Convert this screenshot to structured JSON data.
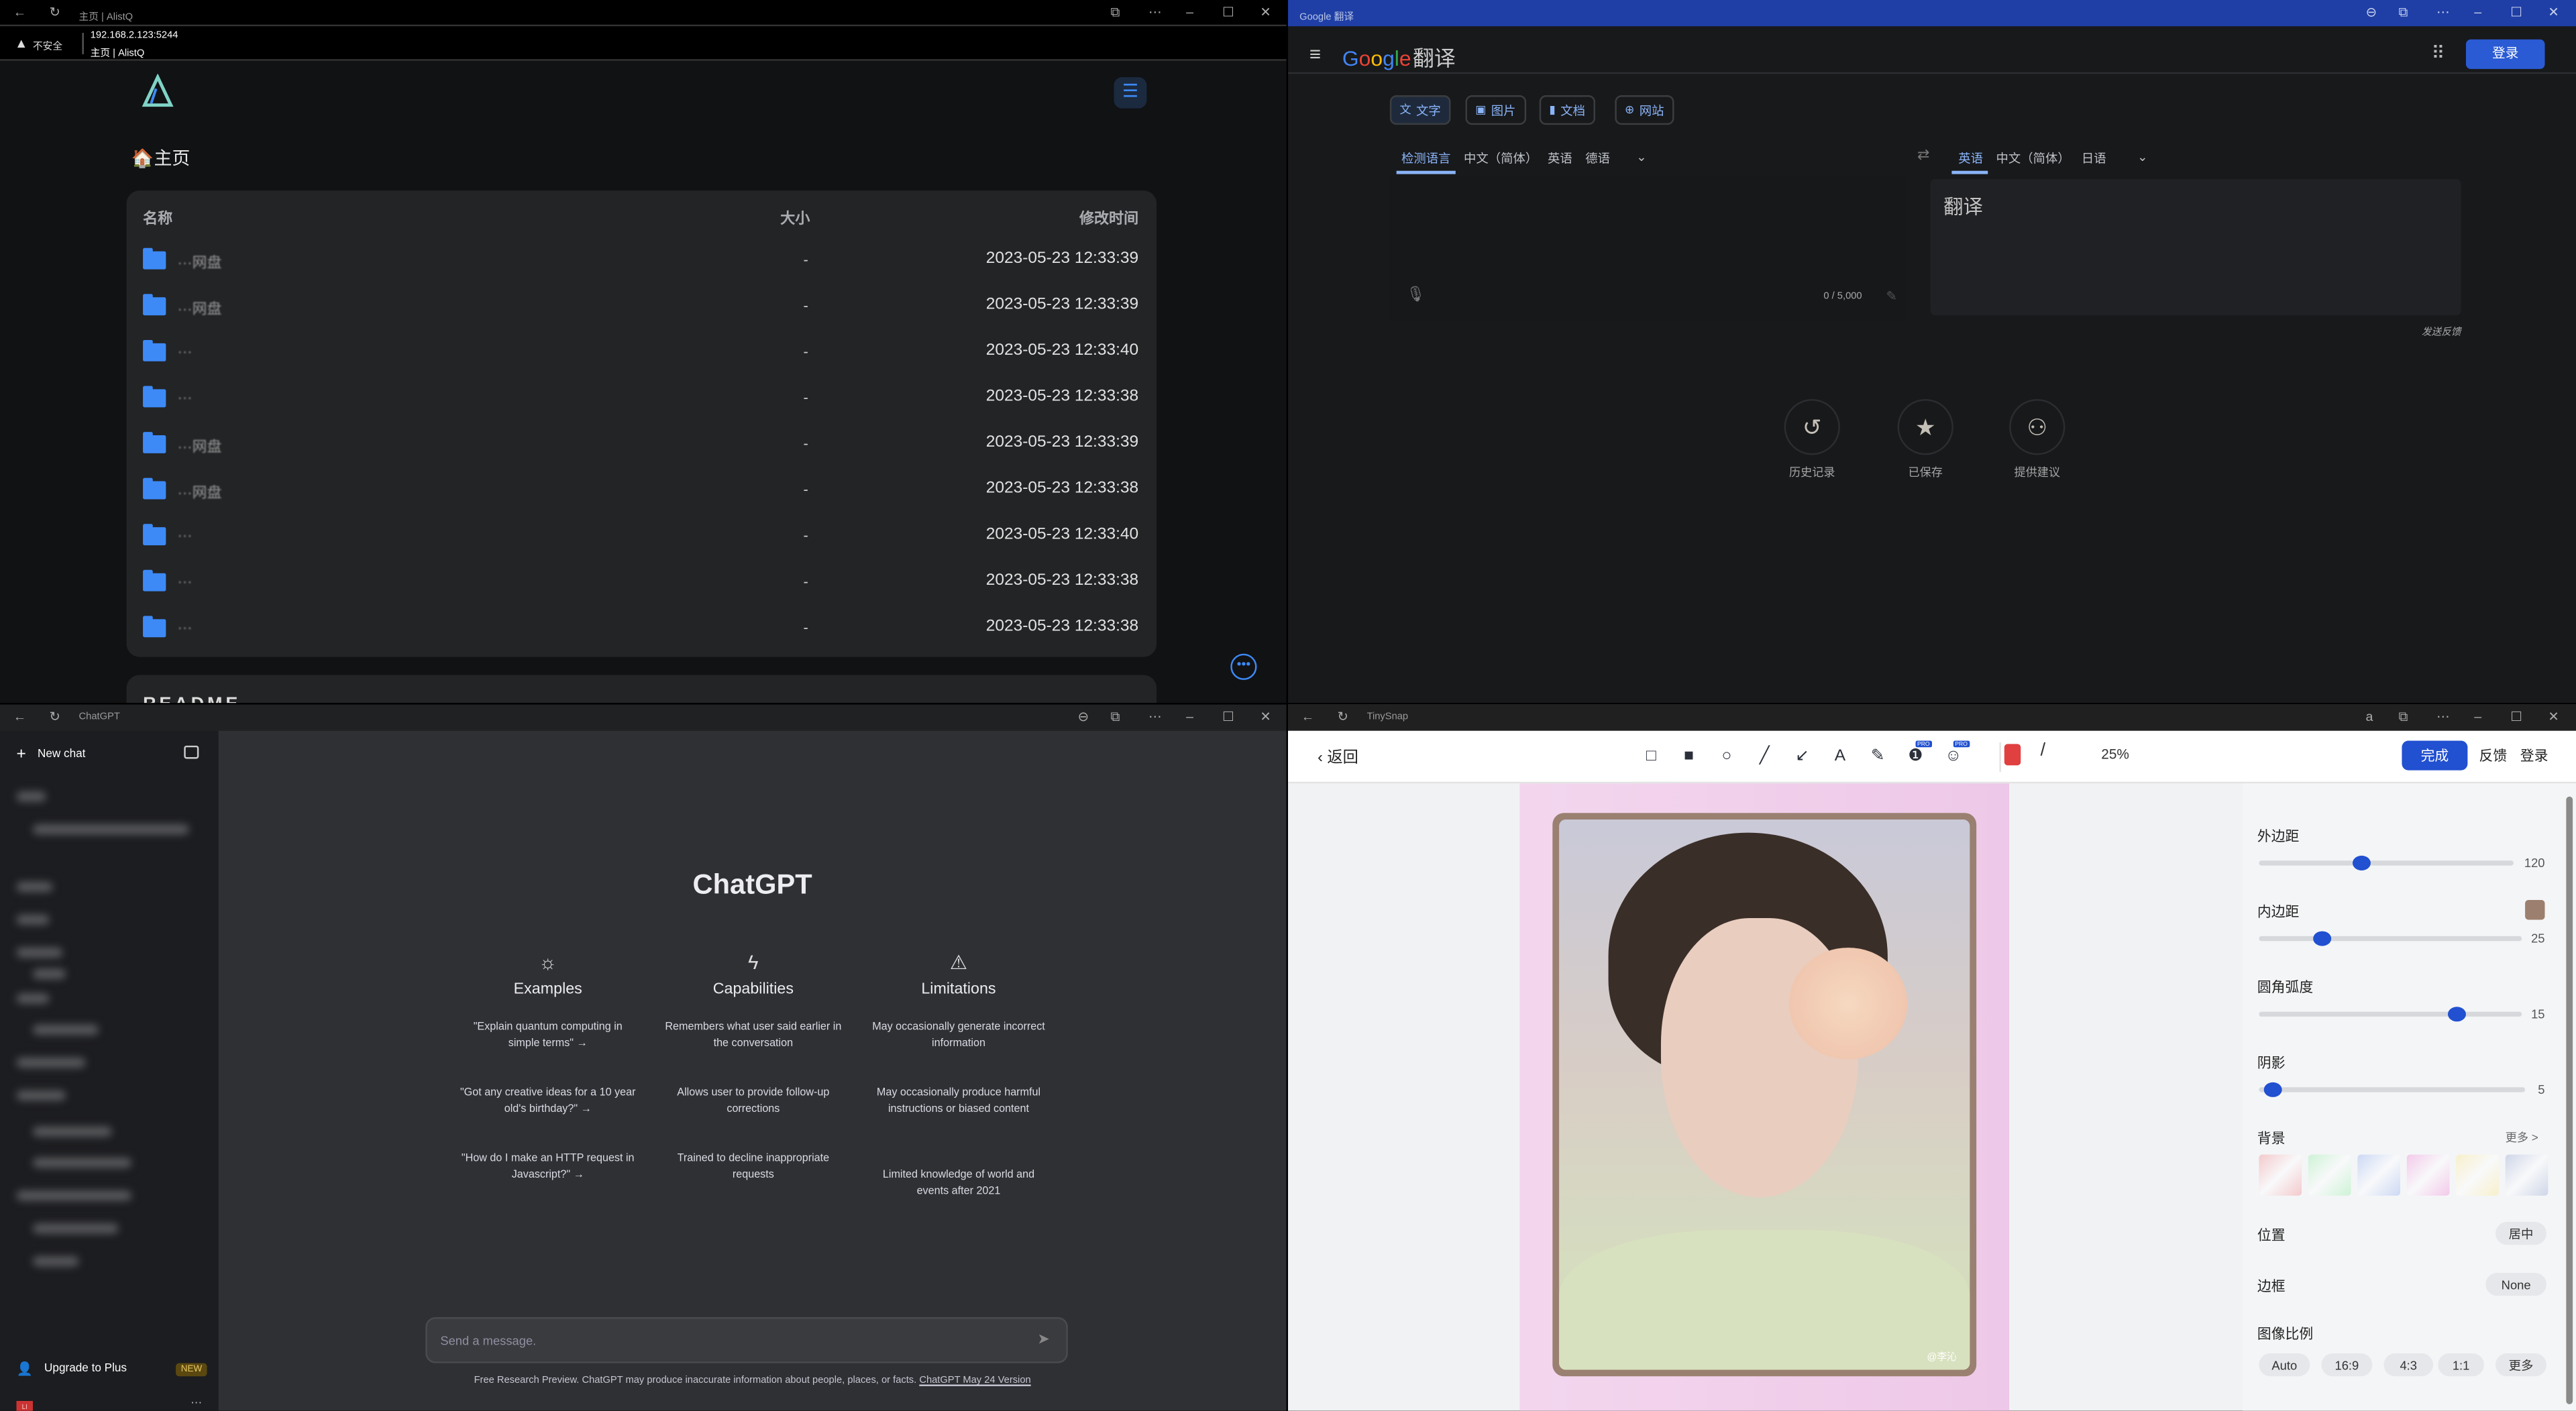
{
  "alist": {
    "window_title": "主页 | AlistQ",
    "security": "不安全",
    "url": "192.168.2.123:5244",
    "page_title": "主页 | AlistQ",
    "breadcrumb": "🏠主页",
    "columns": {
      "name": "名称",
      "size": "大小",
      "modified": "修改时间"
    },
    "files": [
      {
        "name": "···网盘",
        "size": "-",
        "modified": "2023-05-23 12:33:39"
      },
      {
        "name": "···网盘",
        "size": "-",
        "modified": "2023-05-23 12:33:39"
      },
      {
        "name": "···",
        "size": "-",
        "modified": "2023-05-23 12:33:40"
      },
      {
        "name": "···",
        "size": "-",
        "modified": "2023-05-23 12:33:38"
      },
      {
        "name": "···网盘",
        "size": "-",
        "modified": "2023-05-23 12:33:39"
      },
      {
        "name": "···网盘",
        "size": "-",
        "modified": "2023-05-23 12:33:38"
      },
      {
        "name": "···",
        "size": "-",
        "modified": "2023-05-23 12:33:40"
      },
      {
        "name": "···",
        "size": "-",
        "modified": "2023-05-23 12:33:38"
      },
      {
        "name": "···",
        "size": "-",
        "modified": "2023-05-23 12:33:38"
      }
    ],
    "readme_title": "README",
    "accent": "#3d8af7"
  },
  "google": {
    "window_title": "Google 翻译",
    "logo": "Google",
    "logo_suffix": "翻译",
    "login": "登录",
    "modes": [
      {
        "label": "文字",
        "icon": "translate-icon"
      },
      {
        "label": "图片",
        "icon": "image-icon"
      },
      {
        "label": "文档",
        "icon": "document-icon"
      },
      {
        "label": "网站",
        "icon": "globe-icon"
      }
    ],
    "source_langs": [
      "检测语言",
      "中文（简体）",
      "英语",
      "德语"
    ],
    "target_langs": [
      "英语",
      "中文（简体）",
      "日语"
    ],
    "char_count": "0 / 5,000",
    "translation_placeholder": "翻译",
    "feedback": "发送反馈",
    "actions": [
      {
        "label": "历史记录",
        "icon": "history-icon"
      },
      {
        "label": "已保存",
        "icon": "star-icon"
      },
      {
        "label": "提供建议",
        "icon": "people-icon"
      }
    ],
    "accent": "#8ab4f8"
  },
  "chatgpt": {
    "window_title": "ChatGPT",
    "new_chat": "New chat",
    "upgrade": "Upgrade to Plus",
    "new_badge": "NEW",
    "avatar": "LI",
    "title": "ChatGPT",
    "columns": [
      {
        "heading": "Examples",
        "icon": "sun-icon",
        "items": [
          "\"Explain quantum computing in simple terms\" →",
          "\"Got any creative ideas for a 10 year old's birthday?\" →",
          "\"How do I make an HTTP request in Javascript?\" →"
        ]
      },
      {
        "heading": "Capabilities",
        "icon": "lightning-icon",
        "items": [
          "Remembers what user said earlier in the conversation",
          "Allows user to provide follow-up corrections",
          "Trained to decline inappropriate requests"
        ]
      },
      {
        "heading": "Limitations",
        "icon": "warning-icon",
        "items": [
          "May occasionally generate incorrect information",
          "May occasionally produce harmful instructions or biased content",
          "Limited knowledge of world and events after 2021"
        ]
      }
    ],
    "input_placeholder": "Send a message.",
    "footer": "Free Research Preview. ChatGPT may produce inaccurate information about people, places, or facts.",
    "footer_link": "ChatGPT May 24 Version"
  },
  "tinysnap": {
    "window_title": "TinySnap",
    "back": "返回",
    "zoom": "25%",
    "done": "完成",
    "feedback": "反馈",
    "login": "登录",
    "pro_badge": "PRO",
    "tools": [
      "rectangle-icon",
      "filled-rectangle-icon",
      "circle-icon",
      "line-icon",
      "arrow-icon",
      "text-icon",
      "pen-icon",
      "number-icon",
      "emoji-icon"
    ],
    "pen_color": "#e04040",
    "photo_credit": "@李沁",
    "settings": {
      "outer_margin": {
        "label": "外边距",
        "value": "120",
        "fraction": 0.4
      },
      "inner_padding": {
        "label": "内边距",
        "value": "25",
        "fraction": 0.24,
        "color": "#9c7f6e"
      },
      "corner_radius": {
        "label": "圆角弧度",
        "value": "15",
        "fraction": 0.75
      },
      "shadow": {
        "label": "阴影",
        "value": "5",
        "fraction": 0.05
      },
      "background": {
        "label": "背景",
        "more": "更多 >",
        "swatches": [
          "#f4c9cc",
          "#cdf3d6",
          "#ccd9f4",
          "#f3c9ea",
          "#f7f0cb",
          "#cfd6e8"
        ]
      },
      "position": {
        "label": "位置",
        "value": "居中"
      },
      "border": {
        "label": "边框",
        "value": "None"
      },
      "ratio": {
        "label": "图像比例",
        "options": [
          "Auto",
          "16:9",
          "4:3",
          "1:1",
          "更多"
        ]
      }
    },
    "accent": "#2150d0"
  }
}
